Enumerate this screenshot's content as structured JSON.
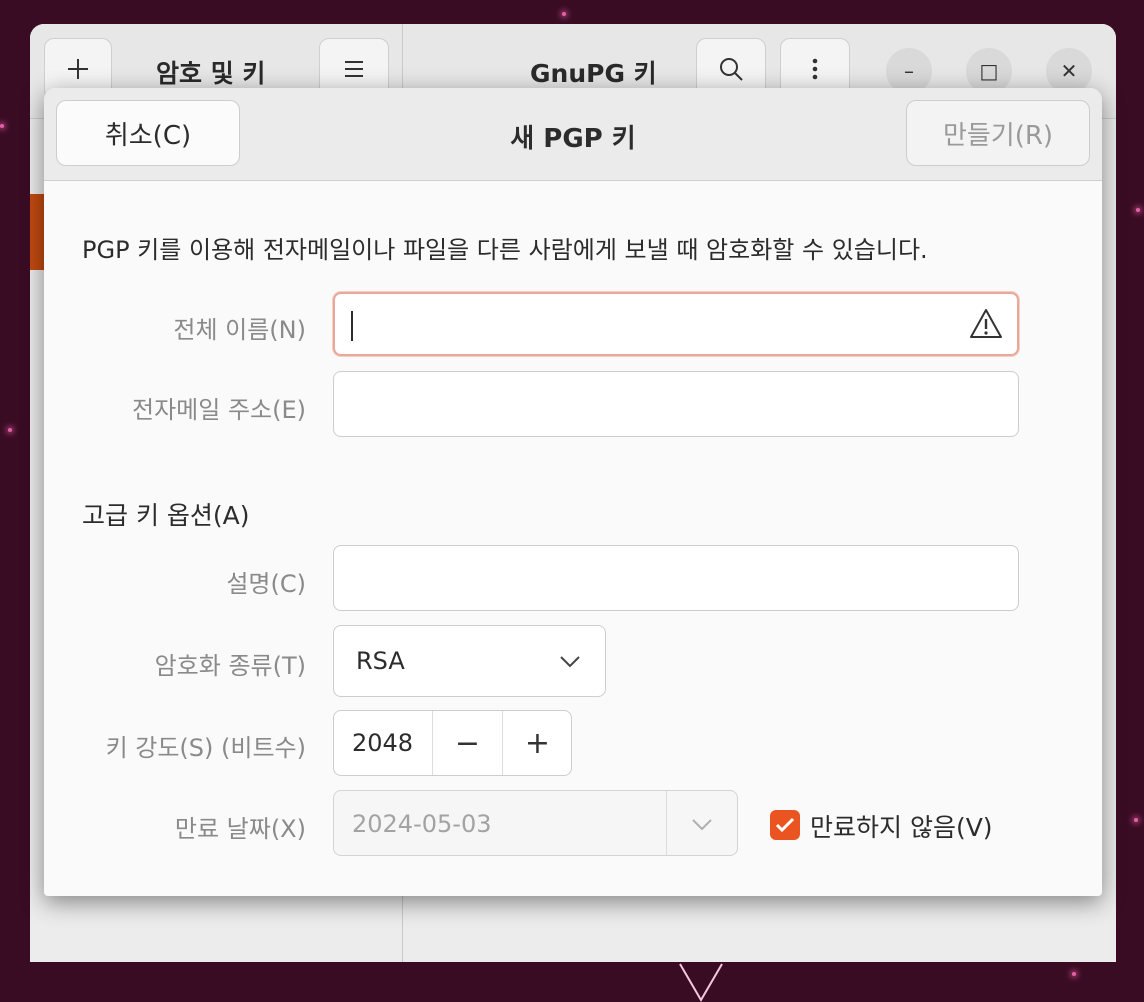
{
  "background_window": {
    "sidebar_title": "암호 및 키",
    "main_title": "GnuPG 키",
    "add_icon": "plus-icon",
    "menu_icon": "hamburger-icon",
    "search_icon": "search-icon",
    "more_icon": "vertical-dots-icon",
    "window_controls": {
      "minimize": "–",
      "maximize": "□",
      "close": "✕"
    }
  },
  "dialog": {
    "title": "새 PGP 키",
    "cancel_label": "취소(C)",
    "create_label": "만들기(R)",
    "intro": "PGP 키를 이용해 전자메일이나 파일을 다른 사람에게 보낼 때 암호화할 수 있습니다.",
    "fields": {
      "full_name_label": "전체 이름(N)",
      "full_name_value": "",
      "email_label": "전자메일 주소(E)",
      "email_value": ""
    },
    "advanced": {
      "section_label": "고급 키 옵션(A)",
      "comment_label": "설명(C)",
      "comment_value": "",
      "encryption_type_label": "암호화 종류(T)",
      "encryption_type_value": "RSA",
      "key_strength_label": "키 강도(S) (비트수)",
      "key_strength_value": "2048",
      "decrement": "−",
      "increment": "+",
      "expiry_label": "만료 날짜(X)",
      "expiry_value": "2024-05-03",
      "never_expires_label": "만료하지 않음(V)",
      "never_expires_checked": true
    }
  },
  "colors": {
    "accent": "#E95420",
    "error_border": "#EAA89A"
  }
}
